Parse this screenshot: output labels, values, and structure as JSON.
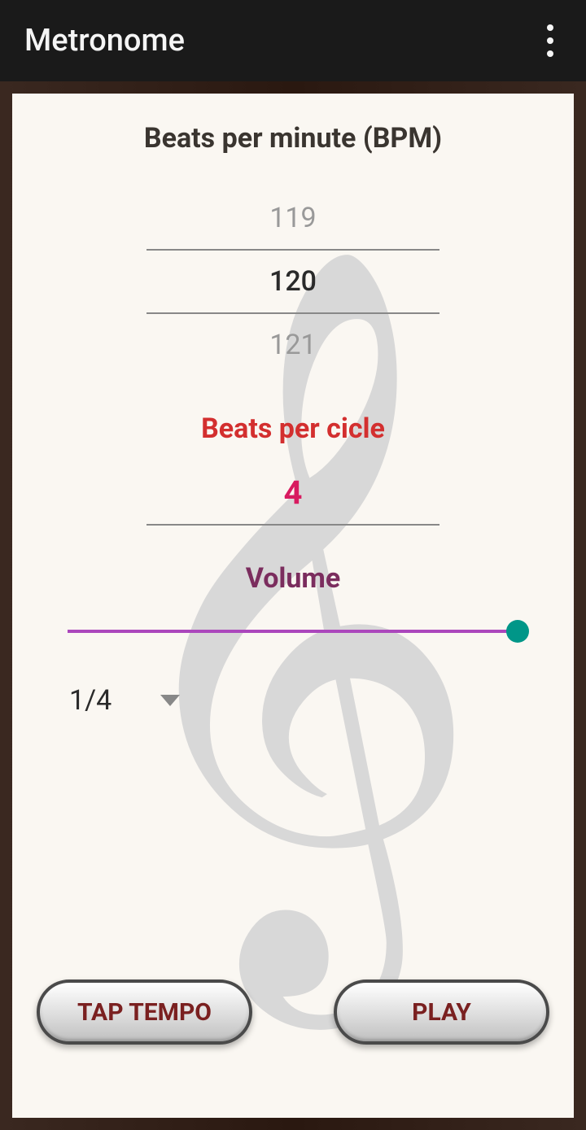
{
  "header": {
    "title": "Metronome"
  },
  "bpm": {
    "label": "Beats per minute (BPM)",
    "prev": "119",
    "current": "120",
    "next": "121"
  },
  "cycle": {
    "label": "Beats per cicle",
    "value": "4"
  },
  "volume": {
    "label": "Volume",
    "percent": 100
  },
  "timeSignature": {
    "selected": "1/4"
  },
  "buttons": {
    "tapTempo": "TAP TEMPO",
    "play": "PLAY"
  }
}
